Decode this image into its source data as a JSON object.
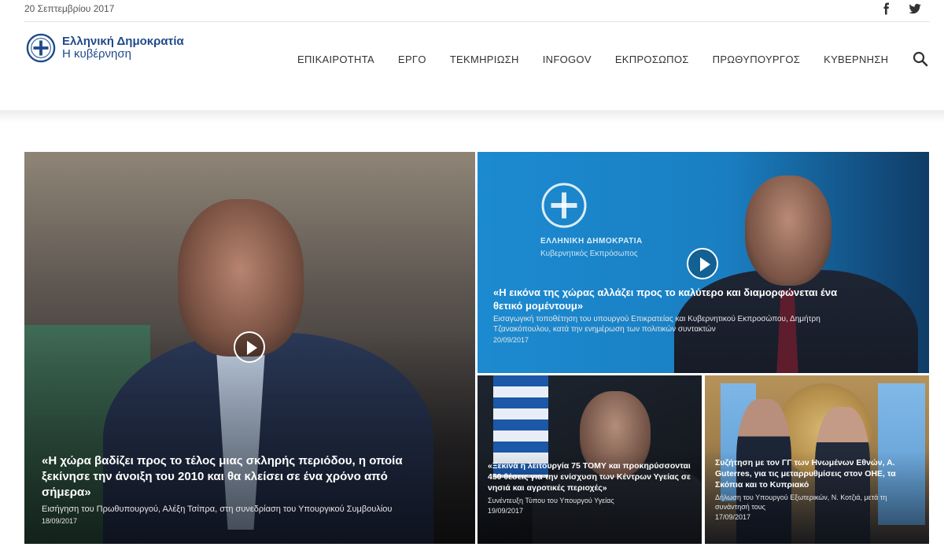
{
  "topbar": {
    "date": "20 Σεπτεμβρίου 2017",
    "social": [
      "facebook-icon",
      "twitter-icon"
    ]
  },
  "header": {
    "logo_line1": "Ελληνική Δημοκρατία",
    "logo_line2": "Η κυβέρνηση",
    "nav": [
      {
        "label": "ΕΠΙΚΑΙΡΟΤΗΤΑ"
      },
      {
        "label": "ΕΡΓΟ"
      },
      {
        "label": "ΤΕΚΜΗΡΙΩΣΗ"
      },
      {
        "label": "INFOGOV"
      },
      {
        "label": "ΕΚΠΡΟΣΩΠΟΣ"
      },
      {
        "label": "ΠΡΩΘΥΠΟΥΡΓΟΣ"
      },
      {
        "label": "ΚΥΒΕΡΝΗΣΗ"
      }
    ],
    "search_icon": "search-icon"
  },
  "colors": {
    "brand_blue": "#1f4a8a",
    "tile2_blue": "#1a7fc2"
  },
  "tiles": [
    {
      "headline": "«Η χώρα βαδίζει προς το τέλος μιας σκληρής περιόδου, η οποία ξεκίνησε την άνοιξη του 2010 και θα κλείσει σε ένα χρόνο από σήμερα»",
      "sub": "Εισήγηση του Πρωθυπουργού, Αλέξη Τσίπρα, στη συνεδρίαση του Υπουργικού Συμβουλίου",
      "date": "18/09/2017",
      "has_video": true
    },
    {
      "headline": "«Η εικόνα της χώρας αλλάζει προς το καλύτερο και διαμορφώνεται ένα θετικό μομέντουμ»",
      "sub": "Εισαγωγική τοποθέτηση του υπουργού Επικρατείας και Κυβερνητικού Εκπροσώπου, Δημήτρη Τζανακόπουλου, κατά την ενημέρωση των πολιτικών συντακτών",
      "date": "20/09/2017",
      "has_video": true,
      "backdrop_line1": "ΕΛΛΗΝΙΚΗ ΔΗΜΟΚΡΑΤΙΑ",
      "backdrop_line2": "Κυβερνητικός Εκπρόσωπος"
    },
    {
      "headline": "«Ξεκινά η λειτουργία 75 ΤΟΜΥ και προκηρύσσονται 450 θέσεις για την ενίσχυση των Κέντρων Υγείας σε νησιά και αγροτικές περιοχές»",
      "sub": "Συνέντευξη Τύπου του Υπουργού Υγείας",
      "date": "19/09/2017",
      "has_video": false
    },
    {
      "headline": "Συζήτηση με τον ΓΓ των Ηνωμένων Εθνών, Α. Guterres, για τις μεταρρυθμίσεις στον ΟΗΕ, τα Σκόπια και το Κυπριακό",
      "sub": "Δήλωση του Υπουργού Εξωτερικών, Ν. Κοτζιά, μετά τη συνάντησή τους",
      "date": "17/09/2017",
      "has_video": false
    }
  ]
}
